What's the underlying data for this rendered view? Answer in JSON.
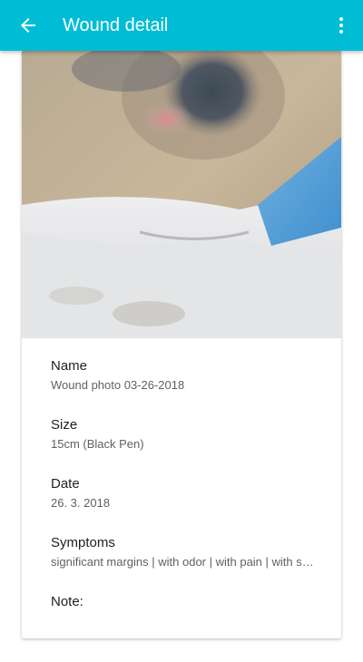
{
  "app_bar": {
    "title": "Wound detail",
    "back_icon": "arrow-left-icon",
    "menu_icon": "more-vertical-icon",
    "color": "#00bcd4"
  },
  "photo": {
    "description_icon": "wound-photo"
  },
  "details": {
    "name": {
      "label": "Name",
      "value": "Wound photo 03-26-2018"
    },
    "size": {
      "label": "Size",
      "value": "15cm (Black Pen)"
    },
    "date": {
      "label": "Date",
      "value": "26. 3. 2018"
    },
    "symptoms": {
      "label": "Symptoms",
      "value": "significant margins | with odor | with pain | with swelling"
    },
    "note": {
      "label": "Note:",
      "value": ""
    }
  }
}
